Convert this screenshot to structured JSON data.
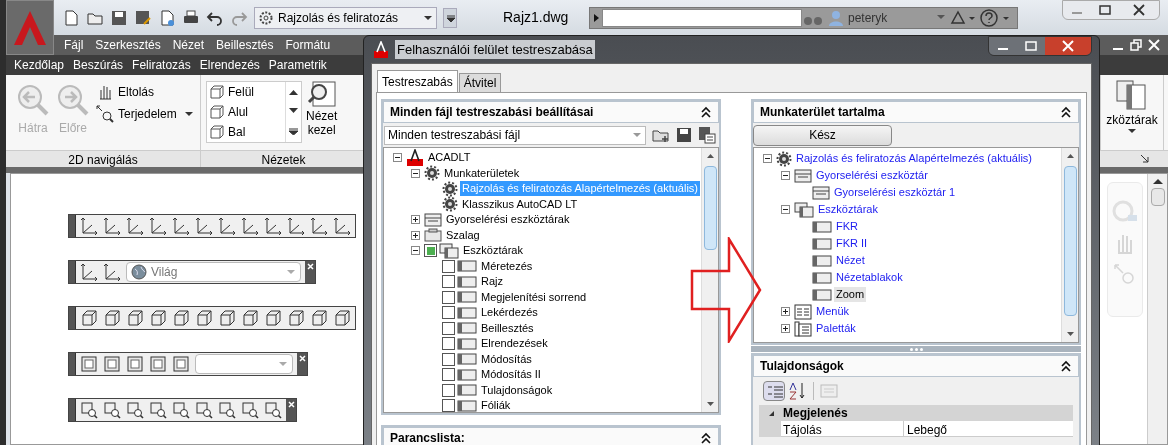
{
  "app": {
    "workspace": "Rajzolás és feliratozás",
    "document_title": "Rajz1.dwg",
    "user": "peteryk",
    "menu": [
      "Fájl",
      "Szerkesztés",
      "Nézet",
      "Beillesztés",
      "Formátu"
    ],
    "ribbon_tabs": [
      "Kezdőlap",
      "Beszúrás",
      "Feliratozás",
      "Elrendezés",
      "Parametrik"
    ],
    "navigation_panel": {
      "title": "2D navigálás",
      "tools": [
        {
          "label": "Hátra",
          "disabled": true
        },
        {
          "label": "Előre",
          "disabled": true
        },
        {
          "label": "Eltolás",
          "disabled": false
        },
        {
          "label": "Terjedelem",
          "disabled": false
        }
      ]
    },
    "views_panel": {
      "title": "Nézetek",
      "views": [
        "Felül",
        "Alul",
        "Bal"
      ],
      "manager": [
        "Nézet",
        "kezel"
      ]
    },
    "right_ribbon_button": "zköztárak",
    "floating_toolbars": [
      {
        "kind": "ucs",
        "closable": false
      },
      {
        "kind": "ucs2",
        "closable": true,
        "dropdown": "Világ"
      },
      {
        "kind": "view",
        "closable": false
      },
      {
        "kind": "viewports",
        "closable": true
      },
      {
        "kind": "zoom",
        "closable": true
      }
    ]
  },
  "dialog": {
    "title": "Felhasználói felület testreszabása",
    "tabs": [
      {
        "label": "Testreszabás",
        "selected": true
      },
      {
        "label": "Átvitel",
        "selected": false
      }
    ],
    "customizations": {
      "title": "Minden fájl testreszabási beállításai",
      "filter": "Minden testreszabási fájl",
      "tree": [
        {
          "label": "ACADLT",
          "kind": "app",
          "expanded": true,
          "selected": false,
          "children": [
            {
              "label": "Munkaterületek",
              "kind": "workspaces",
              "expanded": true,
              "selected": false,
              "children": [
                {
                  "label": "Rajzolás és feliratozás Alapértelmezés (aktuális)",
                  "kind": "workspace",
                  "selected": true
                },
                {
                  "label": "Klasszikus AutoCAD LT",
                  "kind": "workspace",
                  "selected": false
                }
              ]
            },
            {
              "label": "Gyorselérési eszköztárak",
              "kind": "qat",
              "expanded": false,
              "selected": false
            },
            {
              "label": "Szalag",
              "kind": "ribbon",
              "expanded": false,
              "selected": false
            },
            {
              "label": "Eszköztárak",
              "kind": "toolbars",
              "expanded": true,
              "selected": false,
              "checked": true,
              "children": [
                {
                  "label": "Méretezés",
                  "kind": "toolbar",
                  "selected": false,
                  "checked": false
                },
                {
                  "label": "Rajz",
                  "kind": "toolbar",
                  "selected": false,
                  "checked": false
                },
                {
                  "label": "Megjelenítési sorrend",
                  "kind": "toolbar",
                  "selected": false,
                  "checked": false
                },
                {
                  "label": "Lekérdezés",
                  "kind": "toolbar",
                  "selected": false,
                  "checked": false
                },
                {
                  "label": "Beillesztés",
                  "kind": "toolbar",
                  "selected": false,
                  "checked": false
                },
                {
                  "label": "Elrendezések",
                  "kind": "toolbar",
                  "selected": false,
                  "checked": false
                },
                {
                  "label": "Módosítás",
                  "kind": "toolbar",
                  "selected": false,
                  "checked": false
                },
                {
                  "label": "Módosítás II",
                  "kind": "toolbar",
                  "selected": false,
                  "checked": false
                },
                {
                  "label": "Tulajdonságok",
                  "kind": "toolbar",
                  "selected": false,
                  "checked": false
                },
                {
                  "label": "Fóliák",
                  "kind": "toolbar",
                  "selected": false,
                  "checked": false
                }
              ]
            }
          ]
        }
      ]
    },
    "command_list": {
      "title": "Parancslista:"
    },
    "workspace_contents": {
      "title": "Munkaterület tartalma",
      "done_button": "Kész",
      "tree": [
        {
          "label": "Rajzolás és feliratozás Alapértelmezés (aktuális)",
          "kind": "workspace",
          "expanded": true,
          "selected": false,
          "children": [
            {
              "label": "Gyorselérési eszköztár",
              "kind": "qat",
              "expanded": true,
              "selected": false,
              "children": [
                {
                  "label": "Gyorselérési eszköztár 1",
                  "kind": "qat",
                  "selected": false
                }
              ]
            },
            {
              "label": "Eszköztárak",
              "kind": "toolbars",
              "expanded": true,
              "selected": false,
              "children": [
                {
                  "label": "FKR",
                  "kind": "toolbar",
                  "selected": false
                },
                {
                  "label": "FKR II",
                  "kind": "toolbar",
                  "selected": false
                },
                {
                  "label": "Nézet",
                  "kind": "toolbar",
                  "selected": false
                },
                {
                  "label": "Nézetablakok",
                  "kind": "toolbar",
                  "selected": false
                },
                {
                  "label": "Zoom",
                  "kind": "toolbar",
                  "selected": true
                }
              ]
            },
            {
              "label": "Menük",
              "kind": "menus",
              "expanded": false,
              "selected": false
            },
            {
              "label": "Paletták",
              "kind": "palettes",
              "expanded": false,
              "selected": false
            }
          ]
        }
      ]
    },
    "properties": {
      "title": "Tulajdonságok",
      "categories": [
        {
          "name": "Megjelenés",
          "expanded": true,
          "rows": [
            {
              "name": "Tájolás",
              "value": "Lebegő"
            }
          ]
        }
      ]
    }
  }
}
